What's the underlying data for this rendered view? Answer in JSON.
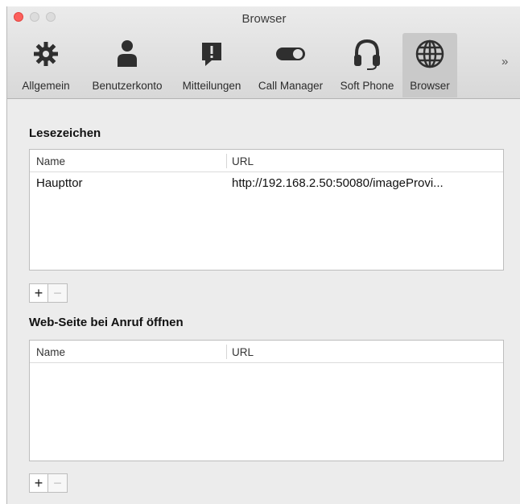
{
  "window": {
    "title": "Browser"
  },
  "toolbar": {
    "tabs": [
      {
        "label": "Allgemein",
        "icon": "gear-icon"
      },
      {
        "label": "Benutzerkonto",
        "icon": "user-icon"
      },
      {
        "label": "Mitteilungen",
        "icon": "message-icon"
      },
      {
        "label": "Call Manager",
        "icon": "toggle-icon"
      },
      {
        "label": "Soft Phone",
        "icon": "headset-icon"
      },
      {
        "label": "Browser",
        "icon": "globe-icon",
        "active": true
      }
    ],
    "overflow": "»"
  },
  "bookmarks": {
    "title": "Lesezeichen",
    "columns": {
      "name": "Name",
      "url": "URL"
    },
    "rows": [
      {
        "name": "Haupttor",
        "url": "http://192.168.2.50:50080/imageProvi..."
      }
    ],
    "add": "+",
    "remove": "−"
  },
  "callpage": {
    "title": "Web-Seite bei Anruf öffnen",
    "columns": {
      "name": "Name",
      "url": "URL"
    },
    "add": "+",
    "remove": "−"
  },
  "colors": {
    "active_tab": "#c9c9c9",
    "close": "#fc605c"
  }
}
